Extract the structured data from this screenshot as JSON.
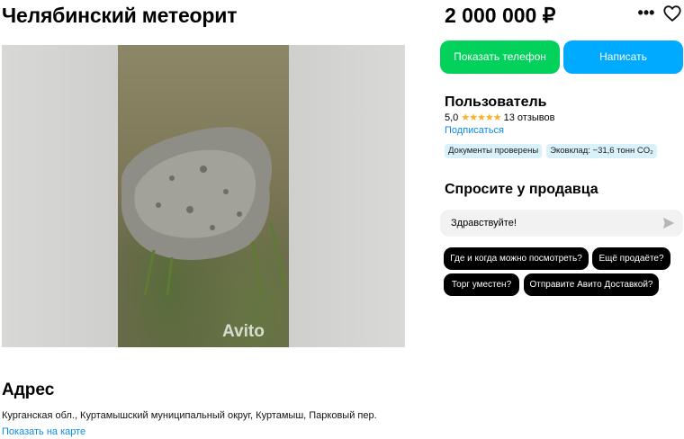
{
  "listing": {
    "title": "Челябинский метеорит",
    "price": "2 000 000 ₽",
    "watermark": "Avito"
  },
  "header_actions": {
    "more_glyph": "•••",
    "more_icon": "more-dots-icon",
    "favorite_icon": "heart-icon"
  },
  "buttons": {
    "show_phone": "Показать телефон",
    "write": "Написать"
  },
  "seller": {
    "name": "Пользователь",
    "rating": "5,0",
    "stars": "★★★★★",
    "reviews": "13 отзывов",
    "subscribe": "Подписаться",
    "badges": [
      "Документы проверены",
      "Эковклад: −31,6 тонн CO₂"
    ]
  },
  "ask": {
    "title": "Спросите у продавца",
    "message_value": "Здравствуйте!",
    "send_icon": "send-icon",
    "quick_questions": [
      "Где и когда можно посмотреть?",
      "Ещё продаёте?",
      "Торг уместен?",
      "Отправите Авито Доставкой?"
    ]
  },
  "address": {
    "title": "Адрес",
    "text": "Курганская обл., Куртамышский муниципальный округ, Куртамыш, Парковый пер.",
    "map_link": "Показать на карте"
  },
  "colors": {
    "green_button": "#02d15c",
    "blue_button": "#00aaff",
    "link": "#0a8ae8",
    "badge_bg": "#d9f1fb",
    "chip_bg": "#000000",
    "star": "#ffb021"
  }
}
